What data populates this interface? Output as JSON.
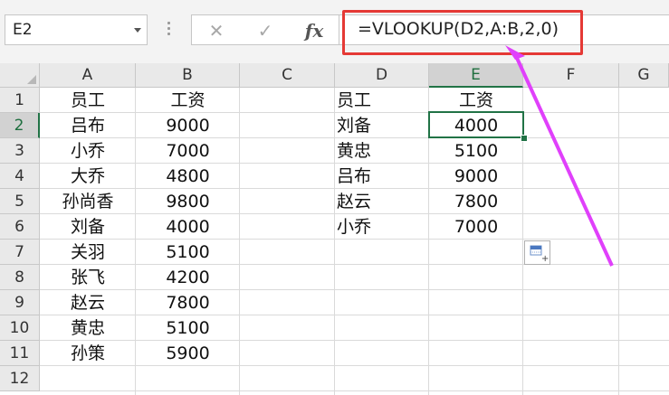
{
  "formula_bar": {
    "name_box": "E2",
    "formula": "=VLOOKUP(D2,A:B,2,0)",
    "cancel_icon": "close-icon",
    "enter_icon": "check-icon",
    "fx_label": "fx"
  },
  "columns": [
    "A",
    "B",
    "C",
    "D",
    "E",
    "F",
    "G"
  ],
  "selected_column": "E",
  "rows": [
    "1",
    "2",
    "3",
    "4",
    "5",
    "6",
    "7",
    "8",
    "9",
    "10",
    "11",
    "12"
  ],
  "selected_row": "2",
  "table_left": {
    "header": [
      "员工",
      "工资"
    ],
    "rows": [
      [
        "吕布",
        "9000"
      ],
      [
        "小乔",
        "7000"
      ],
      [
        "大乔",
        "4800"
      ],
      [
        "孙尚香",
        "9800"
      ],
      [
        "刘备",
        "4000"
      ],
      [
        "关羽",
        "5100"
      ],
      [
        "张飞",
        "4200"
      ],
      [
        "赵云",
        "7800"
      ],
      [
        "黄忠",
        "5100"
      ],
      [
        "孙策",
        "5900"
      ]
    ]
  },
  "table_right": {
    "header": [
      "员工",
      "工资"
    ],
    "rows": [
      [
        "刘备",
        "4000"
      ],
      [
        "黄忠",
        "5100"
      ],
      [
        "吕布",
        "9000"
      ],
      [
        "赵云",
        "7800"
      ],
      [
        "小乔",
        "7000"
      ]
    ]
  },
  "annotation": {
    "highlight_color": "#e53935",
    "arrow_color": "#e040fb"
  },
  "paste_options_icon": "paste-options-icon"
}
